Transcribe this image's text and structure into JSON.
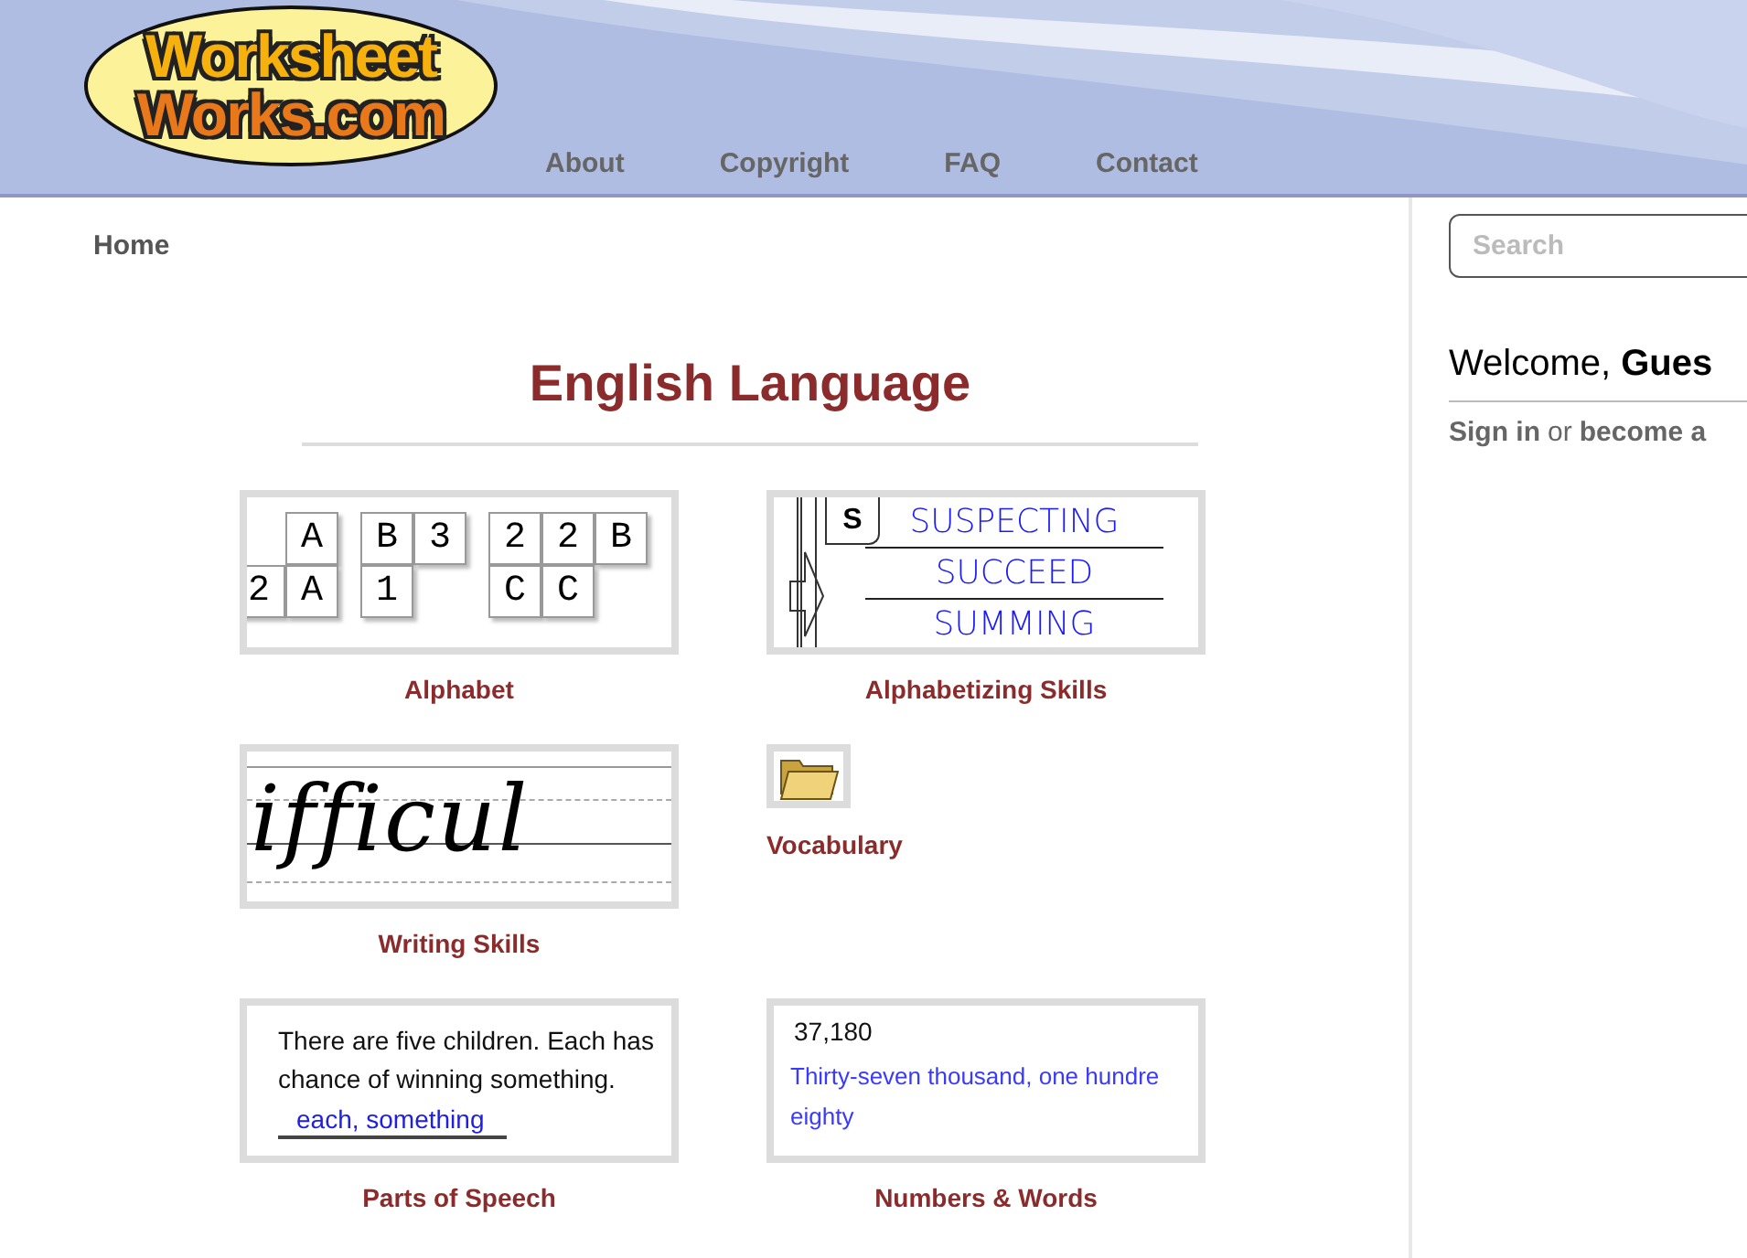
{
  "header": {
    "logo": [
      "Worksheet",
      "Works.com"
    ],
    "nav": [
      {
        "label": "About"
      },
      {
        "label": "Copyright"
      },
      {
        "label": "FAQ"
      },
      {
        "label": "Contact"
      }
    ]
  },
  "breadcrumb": "Home",
  "title": "English Language",
  "topics": [
    {
      "kind": "alphabet",
      "caption": "Alphabet",
      "tiles": [
        [
          {
            "kind": "blank"
          },
          {
            "kind": "tile",
            "text": "A"
          },
          {
            "kind": "tile",
            "text": "B"
          },
          {
            "kind": "tile",
            "text": "3"
          },
          {
            "kind": "tile",
            "text": "2"
          },
          {
            "kind": "tile",
            "text": "2"
          },
          {
            "kind": "tile",
            "text": "B"
          }
        ],
        [
          {
            "kind": "tile",
            "text": "2"
          },
          {
            "kind": "tile",
            "text": "A"
          },
          {
            "kind": "tile",
            "text": "1"
          },
          {
            "kind": "blank"
          },
          {
            "kind": "tile",
            "text": "C"
          },
          {
            "kind": "tile",
            "text": "C"
          },
          {
            "kind": "blank"
          }
        ]
      ]
    },
    {
      "kind": "alphabetizing",
      "caption": "Alphabetizing Skills",
      "letter": "S",
      "words": [
        "SUSPECTING",
        "SUCCEED",
        "SUMMING"
      ]
    },
    {
      "kind": "cursive",
      "caption": "Writing Skills",
      "text": "ifficul"
    },
    {
      "kind": "folder",
      "caption": "Vocabulary"
    },
    {
      "kind": "sentence",
      "caption": "Parts of Speech",
      "lines": [
        "There are five children. Each has",
        "chance of winning something."
      ],
      "answer": "each, something"
    },
    {
      "kind": "number",
      "caption": "Numbers & Words",
      "number": "37,180",
      "words": [
        "Thirty-seven thousand, one hundre",
        "eighty"
      ]
    }
  ],
  "sidebar": {
    "search": {
      "placeholder": "Search"
    },
    "welcome": "Welcome, **Gues**",
    "account": [
      {
        "kind": "link",
        "text": "Sign in"
      },
      {
        "kind": "plain",
        "text": "or"
      },
      {
        "kind": "link",
        "text": "become a"
      }
    ]
  }
}
